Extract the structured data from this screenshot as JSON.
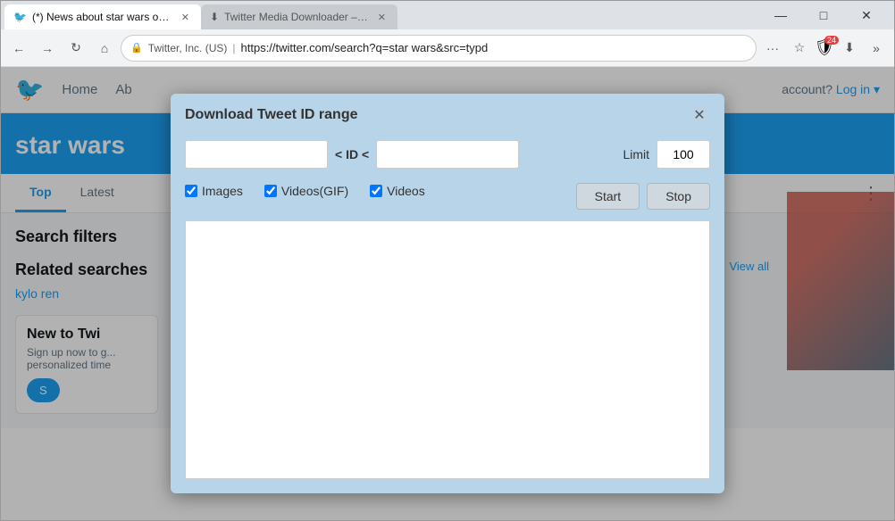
{
  "browser": {
    "tabs": [
      {
        "id": "tab-twitter",
        "title": "(*) News about star wars on Twitter",
        "active": true,
        "favicon": "🐦"
      },
      {
        "id": "tab-downloader",
        "title": "Twitter Media Downloader – Add-o",
        "active": false,
        "favicon": "⬇"
      }
    ],
    "window_controls": {
      "minimize": "—",
      "maximize": "□",
      "close": "✕"
    },
    "address_bar": {
      "security": "🔒",
      "company": "Twitter, Inc. (US)",
      "url": "https://twitter.com/search?q=star wars&src=typd"
    },
    "nav": {
      "back": "←",
      "forward": "→",
      "refresh": "↻",
      "home": "⌂"
    }
  },
  "page": {
    "twitter": {
      "logo": "🐦",
      "nav_items": [
        "Home",
        "Ab"
      ],
      "login_text": "account?",
      "login_link": "Log in",
      "search_term": "star wars",
      "tabs": [
        "Top",
        "Latest"
      ],
      "active_tab": "Top",
      "sidebar": {
        "filters_title": "Search filters",
        "related_title": "Related searches",
        "related_link": "kylo ren",
        "new_section": {
          "title": "New to Twi",
          "description": "Sign up now to g... personalized time",
          "signup_btn": "S"
        }
      },
      "view_all": "View all",
      "more_vert": "⋮"
    }
  },
  "modal": {
    "title": "Download Tweet ID range",
    "close_btn": "✕",
    "id_separator": "< ID <",
    "id_start_placeholder": "",
    "id_end_placeholder": "",
    "limit_label": "Limit",
    "limit_value": "100",
    "checkboxes": [
      {
        "id": "chk-images",
        "label": "Images",
        "checked": true
      },
      {
        "id": "chk-videos-gif",
        "label": "Videos(GIF)",
        "checked": true
      },
      {
        "id": "chk-videos",
        "label": "Videos",
        "checked": true
      }
    ],
    "start_btn": "Start",
    "stop_btn": "Stop",
    "output_placeholder": ""
  }
}
